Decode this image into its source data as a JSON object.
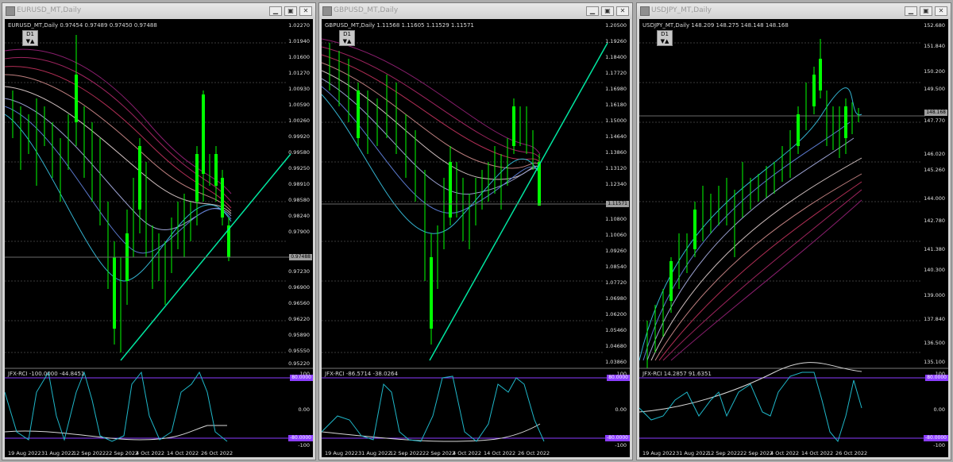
{
  "windows": [
    {
      "id": "eurusd",
      "title": "EURUSD_MT,Daily",
      "header": "EURUSD_MT,Daily  0.97454 0.97489 0.97450 0.97488",
      "timeframe": "D1",
      "price_ticks": [
        "1.02270",
        "1.01940",
        "1.01600",
        "1.01270",
        "1.00930",
        "1.00590",
        "1.00260",
        "0.99920",
        "0.99580",
        "0.99250",
        "0.98910",
        "0.98580",
        "0.98240",
        "0.97900",
        "0.97570",
        "0.97230",
        "0.96900",
        "0.96560",
        "0.96220",
        "0.95890",
        "0.95550",
        "0.95220"
      ],
      "current_price": "0.97488",
      "indicator_header": "JFX-RCI -100.0000 -44.8451",
      "rci_ticks": [
        "100",
        "80.0000",
        "0.00",
        "-80.0000",
        "-100"
      ],
      "date_ticks": [
        "19 Aug 2022",
        "31 Aug 2022",
        "12 Sep 2022",
        "22 Sep 2022",
        "4 Oct 2022",
        "14 Oct 2022",
        "26 Oct 2022"
      ]
    },
    {
      "id": "gbpusd",
      "title": "GBPUSD_MT,Daily",
      "header": "GBPUSD_MT,Daily  1.11568 1.11605 1.11529 1.11571",
      "timeframe": "D1",
      "price_ticks": [
        "1.20500",
        "1.19260",
        "1.18400",
        "1.17720",
        "1.16980",
        "1.16180",
        "1.15000",
        "1.14640",
        "1.13860",
        "1.13120",
        "1.12340",
        "1.11571",
        "1.10800",
        "1.10060",
        "1.09260",
        "1.08540",
        "1.07720",
        "1.06980",
        "1.06200",
        "1.05460",
        "1.04680",
        "1.03860"
      ],
      "current_price": "1.11571",
      "indicator_header": "JFX-RCI -86.5714 -38.0264",
      "rci_ticks": [
        "100",
        "80.0000",
        "0.00",
        "-80.0000",
        "-100"
      ],
      "date_ticks": [
        "19 Aug 2022",
        "31 Aug 2022",
        "12 Sep 2022",
        "22 Sep 2022",
        "4 Oct 2022",
        "14 Oct 2022",
        "26 Oct 2022"
      ]
    },
    {
      "id": "usdjpy",
      "title": "USDJPY_MT,Daily",
      "header": "USDJPY_MT,Daily  148.209 148.275 148.148 148.168",
      "timeframe": "D1",
      "price_ticks": [
        "152.680",
        "151.840",
        "150.200",
        "149.500",
        "147.770",
        "146.020",
        "145.260",
        "144.000",
        "142.780",
        "141.380",
        "140.300",
        "139.000",
        "137.840",
        "136.500",
        "135.100"
      ],
      "current_price": "148.168",
      "indicator_header": "JFX-RCI 14.2857 91.6351",
      "rci_ticks": [
        "100",
        "80.0000",
        "0.00",
        "-80.0000",
        "-100"
      ],
      "date_ticks": [
        "19 Aug 2022",
        "31 Aug 2022",
        "12 Sep 2022",
        "22 Sep 2022",
        "4 Oct 2022",
        "14 Oct 2022",
        "26 Oct 2022"
      ]
    }
  ],
  "colors": {
    "candle": "#00ff00",
    "trendline": "#00e6a0",
    "rci_fast": "#1fb7c9",
    "rci_slow": "#d8d8d8",
    "rci_band": "#8b3dff"
  },
  "icons": {
    "minimize": "minimize-icon",
    "restore": "restore-icon",
    "close": "close-icon"
  }
}
